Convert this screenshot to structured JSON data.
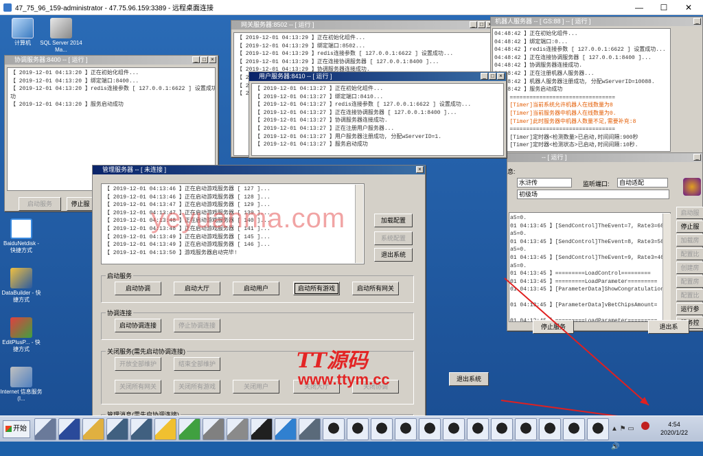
{
  "rdp": {
    "title": "47_75_96_159-administrator - 47.75.96.159:3389 - 远程桌面连接",
    "min": "—",
    "max": "☐",
    "close": "✕"
  },
  "desktop": {
    "icons": [
      "计算机",
      "SQL Server 2014 Ma...",
      "BaiduNetdisk - 快捷方式",
      "DataBuilder - 快捷方式",
      "EditPlusP... - 快捷方式",
      "Internet 信息服务 (I..."
    ]
  },
  "coord": {
    "title": "协调服务器:8400 -- [ 运行 ]",
    "log": [
      "【 2019-12-01 04:13:20 】正在初始化组件...",
      "【 2019-12-01 04:13:20 】绑定端口:8400...",
      "【 2019-12-01 04:13:20 】redis连接参数 [ 127.0.0.1:6622 ] 设置成功",
      "功",
      "【 2019-12-01 04:13:20 】服务启动成功"
    ],
    "btn_start": "启动服务",
    "btn_stop": "停止服"
  },
  "gateway": {
    "title": "网关服务器:8502 -- [ 运行 ]",
    "log": [
      "【 2019-12-01 04:13:29 】正在初始化组件...",
      "【 2019-12-01 04:13:29 】绑定端口:8502...",
      "【 2019-12-01 04:13:29 】redis连接参数 [ 127.0.0.1:6622 ] 设置成功...",
      "【 2019-12-01 04:13:29 】正在连接协调服务器 [ 127.0.0.1:8400 ]...",
      "【 2019-12-01 04:13:29 】协调服务器连接成功."
    ],
    "left_frag": [
      "【 20",
      "【 20",
      "【 20"
    ]
  },
  "user": {
    "title": "用户服务器:8410 -- [ 运行 ]",
    "log": [
      "【 2019-12-01 04:13:27 】正在初始化组件...",
      "【 2019-12-01 04:13:27 】绑定端口:8410...",
      "【 2019-12-01 04:13:27 】redis连接参数 [ 127.0.0.1:6622 ] 设置成功...",
      "【 2019-12-01 04:13:27 】正在连接协调服务器 [ 127.0.0.1:8400 ]...",
      "【 2019-12-01 04:13:27 】协调服务器连接成功.",
      "【 2019-12-01 04:13:27 】正在注册用户服务器...",
      "【 2019-12-01 04:13:27 】用户服务器注册成功, 分配wServerID=1.",
      "【 2019-12-01 04:13:27 】服务启动成功"
    ]
  },
  "robot": {
    "title": "机器人服务器 -- [ GS:88 ] -- [ 运行 ]",
    "log": [
      {
        "t": "04:48:42 】正在初始化组件...",
        "o": false
      },
      {
        "t": "04:48:42 】绑定端口:0...",
        "o": false
      },
      {
        "t": "04:48:42 】redis连接参数 [ 127.0.0.1:6622 ] 设置成功...",
        "o": false
      },
      {
        "t": "04:48:42 】正在连接协调服务器 [ 127.0.0.1:8400 ]...",
        "o": false
      },
      {
        "t": "04:48:42 】协调服务器连接成功.",
        "o": false
      },
      {
        "t": "04:48:42 】正在注册机器人服务器...",
        "o": false
      },
      {
        "t": "04:48:42 】机器人服务器注册成功, 分配wServerID=10088.",
        "o": false
      },
      {
        "t": "04:48:42 】服务启动成功",
        "o": false
      },
      {
        "t": "42 】================================",
        "o": false
      },
      {
        "t": "42 】[Timer]当前系统允许机器人在线数量为8",
        "o": true
      },
      {
        "t": "42 】[Timer]当前服务器中机器人在线数量为0.",
        "o": true
      },
      {
        "t": "42 】[Timer]此时服务器中机器人数量不足,需要补充:8",
        "o": true
      },
      {
        "t": "42 】================================",
        "o": false
      },
      {
        "t": "42 】[Timer]定时器<检测数量>已启动,时间间隔:900秒",
        "o": false
      },
      {
        "t": "42 】[Timer]定时器<检测状态>已启动,时间间隔:10秒.",
        "o": false
      }
    ]
  },
  "game": {
    "title": "-- [ 运行 ]",
    "info_label": "息:",
    "name": "水浒传",
    "port_label": "监听端口:",
    "port_value": "自动适配",
    "room": "初级场",
    "log": [
      "a5=0.",
      "01 04:13:45 】[SendControl]TheEvent=7, Rate3=60,",
      "a5=0.",
      "01 04:13:45 】[SendControl]TheEvent=8, Rate3=50,",
      "a5=0.",
      "01 04:13:45 】[SendControl]TheEvent=9, Rate3=40,",
      "a5=0.",
      "01 04:13:45 】=========LoadControl=========",
      "01 04:13:45 】=========LoadParameter=========",
      "01 04:13:45 】[ParameterData]ShowCongratulations=",
      "",
      "01 04:13:45 】[ParameterData]vBetChipsAmount=",
      "",
      "01 04:13:45 】=========LoadParameter========="
    ],
    "side_buttons": [
      "启动服",
      "停止服",
      "加载房",
      "配置比",
      "创建房",
      "配置房",
      "配置比",
      "运行参",
      "服务控"
    ]
  },
  "mgr": {
    "title": "管理服务器 -- [ 未连接 ]",
    "log": [
      "【 2019-12-01 04:13:46 】正在启动游戏服务器 [ 127 ]...",
      "【 2019-12-01 04:13:46 】正在启动游戏服务器 [ 128 ]...",
      "【 2019-12-01 04:13:47 】正在启动游戏服务器 [ 129 ]...",
      "【 2019-12-01 04:13:47 】正在启动游戏服务器 [ 139 ]...",
      "【 2019-12-01 04:13:48 】正在启动游戏服务器 [ 140 ]...",
      "【 2019-12-01 04:13:48 】正在启动游戏服务器 [ 141 ]...",
      "【 2019-12-01 04:13:49 】正在启动游戏服务器 [ 145 ]...",
      "【 2019-12-01 04:13:49 】正在启动游戏服务器 [ 146 ]...",
      "【 2019-12-01 04:13:50 】游戏服务器启动完毕!"
    ],
    "btn_load": "加载配置",
    "btn_sysconf": "系统配置",
    "btn_exit": "退出系统",
    "grp_start": "启动服务",
    "start_btns": [
      "启动协调",
      "启动大厅",
      "启动用户",
      "启动所有游戏",
      "启动所有网关"
    ],
    "grp_coord": "协调连接",
    "coord_btns": [
      "启动协调连接",
      "停止协调连接"
    ],
    "grp_close": "关闭服务(需先启动协调连接)",
    "close_btns_row1": [
      "开放全部维护",
      "结束全部维护"
    ],
    "close_btns_row2": [
      "关闭所有网关",
      "关闭所有游戏",
      "关闭用户",
      "关闭大厅",
      "关闭协调"
    ],
    "grp_msg": "管理消息(需先启协调连接)"
  },
  "misc": {
    "exit2": "退出系统",
    "stop2": "停止服务",
    "exit3": "退出系"
  },
  "watermark": "yeyuanma.com",
  "logo": {
    "brand": "TT源码",
    "url": "www.ttym.cc"
  },
  "taskbar": {
    "start": "开始",
    "time": "4:54",
    "date": "2020/1/22",
    "lang": "中"
  }
}
